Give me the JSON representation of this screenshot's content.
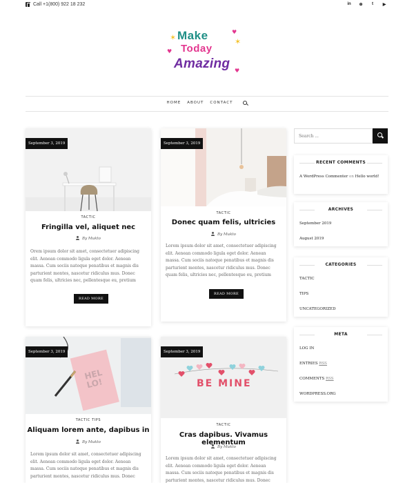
{
  "topbar": {
    "call_text": "Call +1(800) 922 18 232",
    "social_icons": [
      "in",
      "⊕",
      "t",
      "▶"
    ]
  },
  "logo": {
    "line1": "Make",
    "line2": "Today",
    "line3": "Amazing"
  },
  "nav": {
    "items": [
      "HOME",
      "ABOUT",
      "CONTACT"
    ]
  },
  "posts": [
    {
      "date": "September 3, 2019",
      "category": "TACTIC",
      "title": "Fringilla vel, aliquet nec",
      "author": "By Mukto",
      "excerpt": "Orem ipsum dolor sit amet, consectetuer adipiscing elit. Aenean commodo ligula eget dolor. Aenean massa. Cum sociis natoque penatibus et magnis dis parturient montes, nascetur ridiculus mus. Donec quam felis, ultricies nec, pellentesque eu, pretium",
      "read_more": "READ MORE"
    },
    {
      "date": "September 3, 2019",
      "category": "TACTIC",
      "title": "Donec quam felis, ultricies",
      "author": "By Mukto",
      "excerpt": "Lorem ipsum dolor sit amet, consectetuer adipiscing elit. Aenean commodo ligula eget dolor. Aenean massa. Cum sociis natoque penatibus et magnis dis parturient montes, nascetur ridiculus mus. Donec quam felis, ultricies nec, pellentesque eu, pretium",
      "read_more": "READ MORE"
    },
    {
      "date": "September 3, 2019",
      "category": "TACTIC   TIPS",
      "title": "Aliquam lorem ante, dapibus in",
      "author": "By Mukto",
      "excerpt": "Lorem ipsum dolor sit amet, consectetuer adipiscing elit. Aenean commodo ligula eget dolor. Aenean massa. Cum sociis natoque penatibus et magnis dis parturient montes, nascetur ridiculus mus. Donec",
      "image_text": "HEL LO!"
    },
    {
      "date": "September 3, 2019",
      "category": "TACTIC",
      "title": "Cras dapibus. Vivamus elementum",
      "author": "By Mukto",
      "excerpt": "Lorem ipsum dolor sit amet, consectetuer adipiscing elit. Aenean commodo ligula eget dolor. Aenean massa. Cum sociis natoque penatibus et magnis dis parturient montes, nascetur ridiculus mus. Donec",
      "image_text": "BE MINE"
    }
  ],
  "sidebar": {
    "search_placeholder": "Search ...",
    "recent_comments": {
      "title": "RECENT COMMENTS",
      "commenter": "A WordPress Commenter",
      "on": "on",
      "post": "Hello world!"
    },
    "archives": {
      "title": "ARCHIVES",
      "items": [
        "September 2019",
        "August 2019"
      ]
    },
    "categories": {
      "title": "CATEGORIES",
      "items": [
        "TACTIC",
        "TIPS",
        "UNCATEGORIZED"
      ]
    },
    "meta": {
      "title": "META",
      "items": [
        "LOG IN",
        "ENTRIES",
        "COMMENTS",
        "WORDPRESS.ORG"
      ],
      "rss": "RSS"
    }
  }
}
